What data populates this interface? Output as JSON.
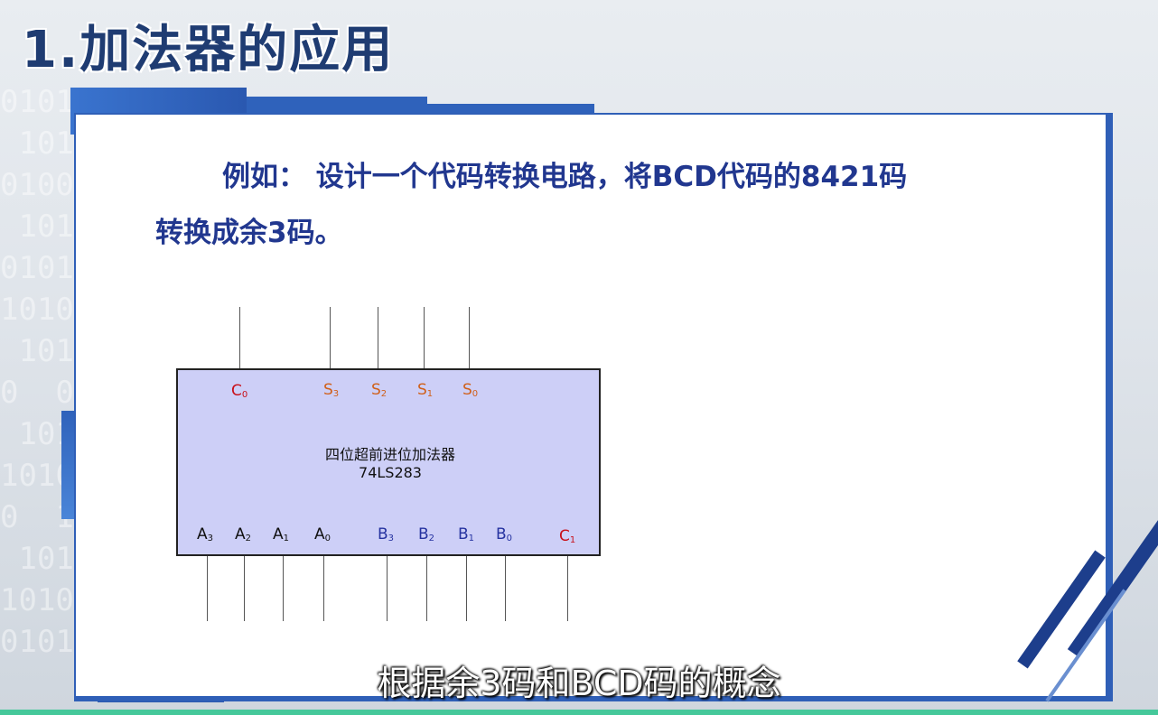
{
  "slide": {
    "title": "1.加法器的应用",
    "example_line1": "例如： 设计一个代码转换电路，将BCD代码的8421码",
    "example_line2": "转换成余3码。"
  },
  "chip": {
    "name": "四位超前进位加法器",
    "model": "74LS283",
    "outputs": [
      {
        "base": "C",
        "sub": "0",
        "color": "#c8101a"
      },
      {
        "base": "S",
        "sub": "3",
        "color": "#d0601a"
      },
      {
        "base": "S",
        "sub": "2",
        "color": "#d0601a"
      },
      {
        "base": "S",
        "sub": "1",
        "color": "#d0601a"
      },
      {
        "base": "S",
        "sub": "0",
        "color": "#d0601a"
      }
    ],
    "inputs": [
      {
        "base": "A",
        "sub": "3",
        "color": "#111111"
      },
      {
        "base": "A",
        "sub": "2",
        "color": "#111111"
      },
      {
        "base": "A",
        "sub": "1",
        "color": "#111111"
      },
      {
        "base": "A",
        "sub": "0",
        "color": "#111111"
      },
      {
        "base": "B",
        "sub": "3",
        "color": "#2532a0"
      },
      {
        "base": "B",
        "sub": "2",
        "color": "#2532a0"
      },
      {
        "base": "B",
        "sub": "1",
        "color": "#2532a0"
      },
      {
        "base": "B",
        "sub": "0",
        "color": "#2532a0"
      },
      {
        "base": "C",
        "sub": "1",
        "color": "#c8101a"
      }
    ]
  },
  "caption": "根据余3码和BCD码的概念",
  "colors": {
    "accent": "#2f5fb7",
    "title_text": "#1f3c72",
    "body_text": "#21378f",
    "chip_fill": "#cdcff7"
  }
}
